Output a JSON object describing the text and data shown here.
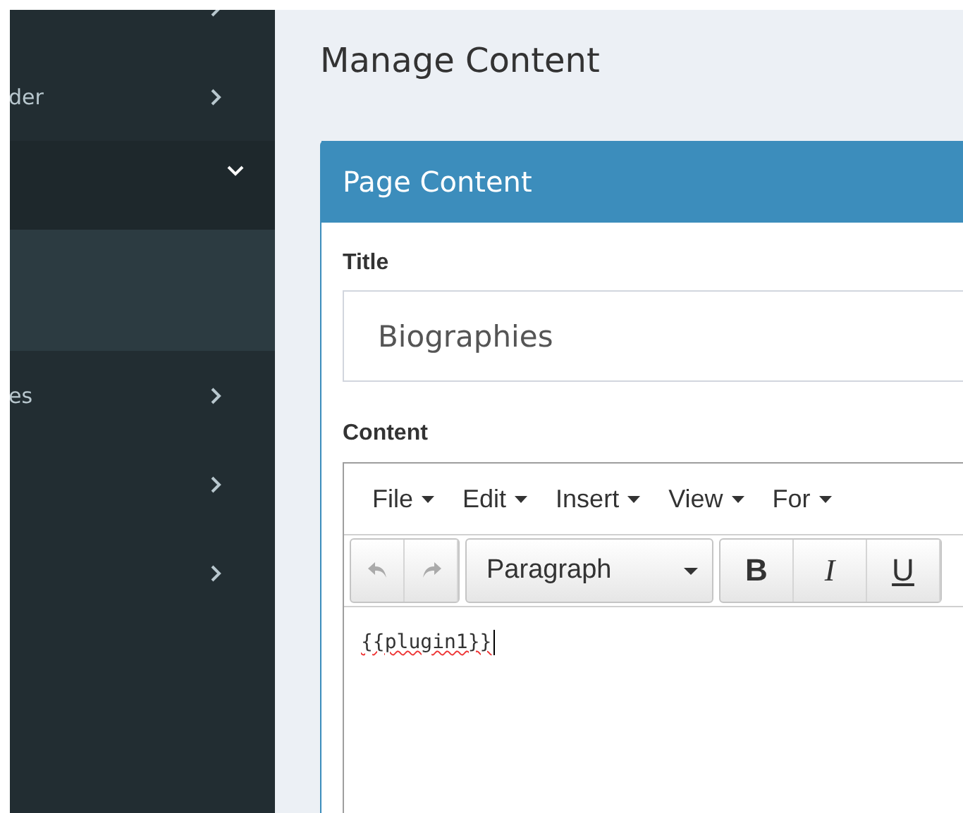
{
  "sidebar": {
    "items": [
      {
        "expanded": false
      },
      {
        "label": "der",
        "expanded": false
      },
      {
        "expanded": true
      },
      {
        "label": "es",
        "expanded": false
      },
      {
        "expanded": false
      },
      {
        "expanded": false
      }
    ]
  },
  "page_title": "Manage Content",
  "card": {
    "title": "Page Content",
    "title_field": {
      "label": "Title",
      "value": "Biographies"
    },
    "content_field": {
      "label": "Content",
      "menu": [
        "File",
        "Edit",
        "Insert",
        "View",
        "For"
      ],
      "history_buttons": [
        {
          "kind": "undo",
          "disabled": true
        },
        {
          "kind": "redo",
          "disabled": true
        }
      ],
      "block_format": "Paragraph",
      "format_buttons": [
        {
          "kind": "bold",
          "label": "B"
        },
        {
          "kind": "italic",
          "label": "I"
        },
        {
          "kind": "underline",
          "label": "U"
        }
      ],
      "text": "{{plugin1}}"
    }
  }
}
